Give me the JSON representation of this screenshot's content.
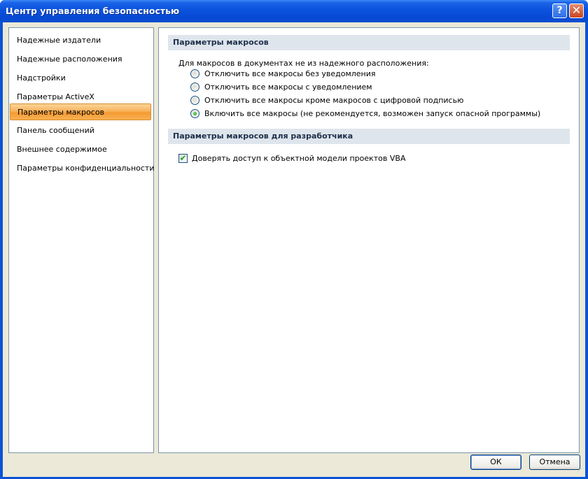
{
  "window": {
    "title": "Центр управления безопасностью",
    "help_glyph": "?",
    "close_glyph": "✕"
  },
  "sidebar": {
    "items": [
      {
        "label": "Надежные издатели",
        "selected": false
      },
      {
        "label": "Надежные расположения",
        "selected": false
      },
      {
        "label": "Надстройки",
        "selected": false
      },
      {
        "label": "Параметры ActiveX",
        "selected": false
      },
      {
        "label": "Параметры макросов",
        "selected": true
      },
      {
        "label": "Панель сообщений",
        "selected": false
      },
      {
        "label": "Внешнее содержимое",
        "selected": false
      },
      {
        "label": "Параметры конфиденциальности",
        "selected": false
      }
    ]
  },
  "macro_settings": {
    "header": "Параметры макросов",
    "caption": "Для макросов в документах не из надежного расположения:",
    "options": [
      {
        "label": "Отключить все макросы без уведомления",
        "checked": false
      },
      {
        "label": "Отключить все макросы с уведомлением",
        "checked": false
      },
      {
        "label": "Отключить все макросы кроме макросов с цифровой подписью",
        "checked": false
      },
      {
        "label": "Включить все макросы (не рекомендуется, возможен запуск опасной программы)",
        "checked": true
      }
    ]
  },
  "developer_settings": {
    "header": "Параметры макросов для разработчика",
    "vba_trust_label": "Доверять доступ к объектной модели проектов VBA",
    "vba_trust_checked": true,
    "check_glyph": "✔"
  },
  "buttons": {
    "ok": "ОК",
    "cancel": "Отмена"
  },
  "colors": {
    "title_bar": "#0a52dc",
    "selected_item": "#f8b25c",
    "section_header_bg": "#dfe5ec"
  }
}
